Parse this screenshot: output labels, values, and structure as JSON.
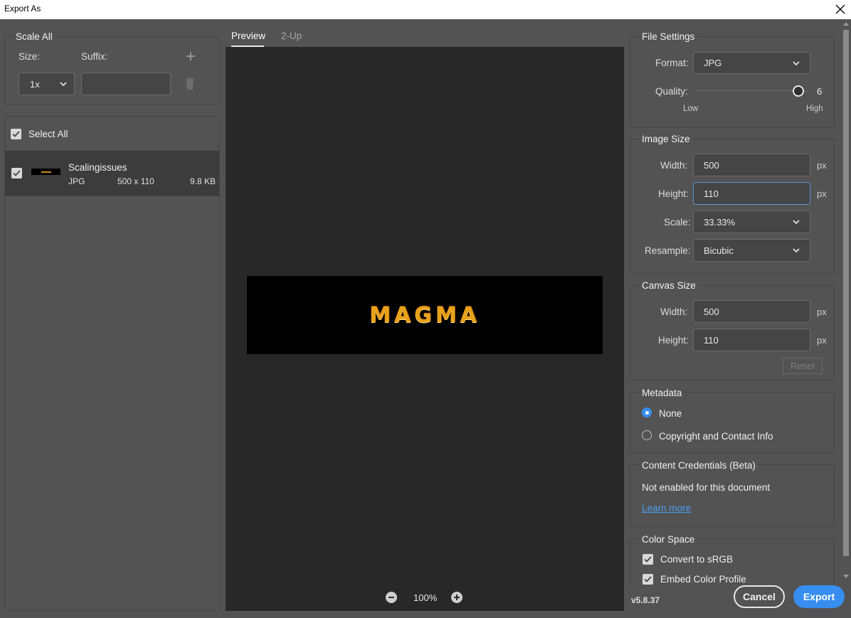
{
  "window": {
    "title": "Export As"
  },
  "scale_all": {
    "legend": "Scale All",
    "size_label": "Size:",
    "suffix_label": "Suffix:",
    "size_value": "1x",
    "suffix_value": ""
  },
  "assets": {
    "select_all_label": "Select All",
    "items": [
      {
        "name": "Scalingissues",
        "format": "JPG",
        "dimensions": "500 x 110",
        "size": "9.8 KB"
      }
    ]
  },
  "preview": {
    "tabs": [
      "Preview",
      "2-Up"
    ],
    "active_tab": "Preview",
    "image_text": "MAGMA",
    "zoom": "100%"
  },
  "file_settings": {
    "legend": "File Settings",
    "format_label": "Format:",
    "format_value": "JPG",
    "quality_label": "Quality:",
    "quality_value": "6",
    "quality_fraction": 0.9,
    "low_label": "Low",
    "high_label": "High"
  },
  "image_size": {
    "legend": "Image Size",
    "width_label": "Width:",
    "width_value": "500",
    "height_label": "Height:",
    "height_value": "110",
    "scale_label": "Scale:",
    "scale_value": "33.33%",
    "resample_label": "Resample:",
    "resample_value": "Bicubic",
    "unit": "px"
  },
  "canvas_size": {
    "legend": "Canvas Size",
    "width_label": "Width:",
    "width_value": "500",
    "height_label": "Height:",
    "height_value": "110",
    "unit": "px",
    "reset_label": "Reset"
  },
  "metadata": {
    "legend": "Metadata",
    "options": [
      "None",
      "Copyright and Contact Info"
    ],
    "selected": "None"
  },
  "content_credentials": {
    "legend": "Content Credentials (Beta)",
    "status": "Not enabled for this document",
    "link": "Learn more"
  },
  "color_space": {
    "legend": "Color Space",
    "convert_label": "Convert to sRGB",
    "embed_label": "Embed Color Profile"
  },
  "footer": {
    "version": "v5.8.37",
    "cancel_label": "Cancel",
    "export_label": "Export"
  },
  "colors": {
    "accent": "#378ef0",
    "preview_bg": "#282828",
    "panel_bg": "#535353",
    "magma_gold": "#e8a21a"
  }
}
